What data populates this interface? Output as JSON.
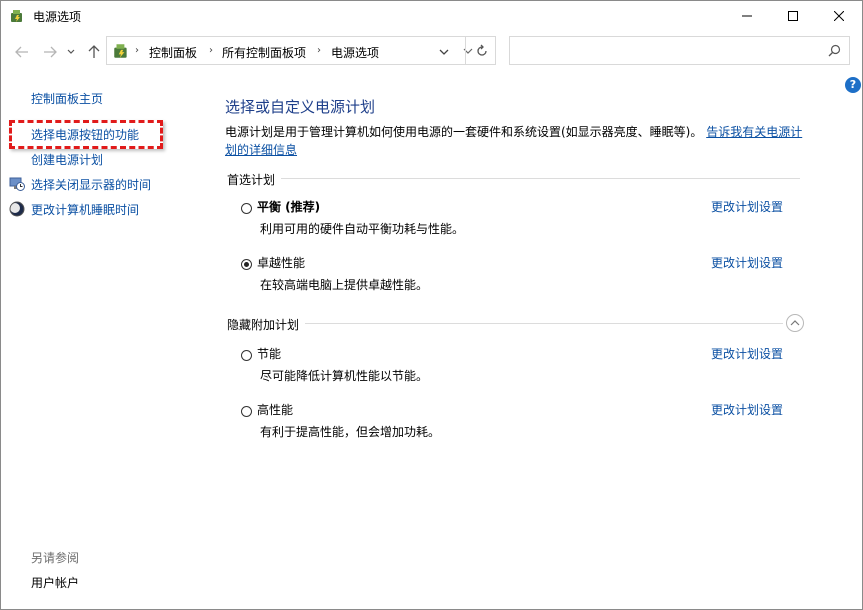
{
  "window": {
    "title": "电源选项"
  },
  "address": {
    "crumbs": [
      "控制面板",
      "所有控制面板项",
      "电源选项"
    ],
    "search_placeholder": ""
  },
  "help": {
    "label": "?"
  },
  "sidebar": {
    "home": "控制面板主页",
    "items": [
      {
        "label": "选择电源按钮的功能",
        "icon": "none",
        "highlighted": true
      },
      {
        "label": "创建电源计划",
        "icon": "none"
      },
      {
        "label": "选择关闭显示器的时间",
        "icon": "monitor-clock-icon"
      },
      {
        "label": "更改计算机睡眠时间",
        "icon": "moon-icon"
      }
    ],
    "see_also": "另请参阅",
    "see_also_items": [
      "用户帐户"
    ]
  },
  "main": {
    "title": "选择或自定义电源计划",
    "description": "电源计划是用于管理计算机如何使用电源的一套硬件和系统设置(如显示器亮度、睡眠等)。",
    "description_link": "告诉我有关电源计划的详细信息",
    "preferred_header": "首选计划",
    "hidden_header": "隐藏附加计划",
    "plans": [
      {
        "name": "平衡 (推荐)",
        "desc": "利用可用的硬件自动平衡功耗与性能。",
        "link": "更改计划设置",
        "selected": false
      },
      {
        "name": "卓越性能",
        "desc": "在较高端电脑上提供卓越性能。",
        "link": "更改计划设置",
        "selected": true
      },
      {
        "name": "节能",
        "desc": "尽可能降低计算机性能以节能。",
        "link": "更改计划设置",
        "selected": false
      },
      {
        "name": "高性能",
        "desc": "有利于提高性能，但会增加功耗。",
        "link": "更改计划设置",
        "selected": false
      }
    ]
  },
  "colors": {
    "link": "#0b50a3",
    "title": "#1e3f8a",
    "highlight": "#e11b1b"
  }
}
